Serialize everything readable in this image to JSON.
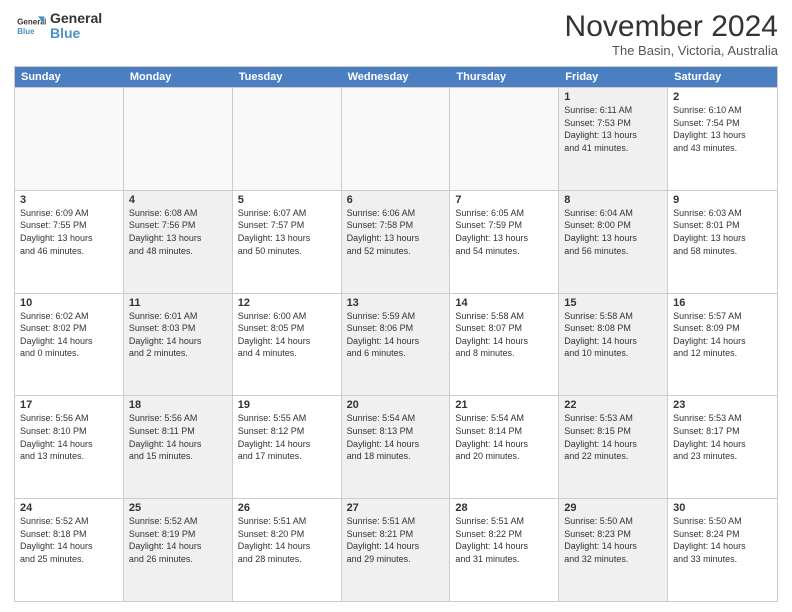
{
  "logo": {
    "line1": "General",
    "line2": "Blue"
  },
  "title": "November 2024",
  "location": "The Basin, Victoria, Australia",
  "header": {
    "days": [
      "Sunday",
      "Monday",
      "Tuesday",
      "Wednesday",
      "Thursday",
      "Friday",
      "Saturday"
    ]
  },
  "rows": [
    [
      {
        "day": "",
        "text": "",
        "empty": true
      },
      {
        "day": "",
        "text": "",
        "empty": true
      },
      {
        "day": "",
        "text": "",
        "empty": true
      },
      {
        "day": "",
        "text": "",
        "empty": true
      },
      {
        "day": "",
        "text": "",
        "empty": true
      },
      {
        "day": "1",
        "text": "Sunrise: 6:11 AM\nSunset: 7:53 PM\nDaylight: 13 hours\nand 41 minutes.",
        "shaded": true
      },
      {
        "day": "2",
        "text": "Sunrise: 6:10 AM\nSunset: 7:54 PM\nDaylight: 13 hours\nand 43 minutes.",
        "shaded": false
      }
    ],
    [
      {
        "day": "3",
        "text": "Sunrise: 6:09 AM\nSunset: 7:55 PM\nDaylight: 13 hours\nand 46 minutes.",
        "shaded": false
      },
      {
        "day": "4",
        "text": "Sunrise: 6:08 AM\nSunset: 7:56 PM\nDaylight: 13 hours\nand 48 minutes.",
        "shaded": true
      },
      {
        "day": "5",
        "text": "Sunrise: 6:07 AM\nSunset: 7:57 PM\nDaylight: 13 hours\nand 50 minutes.",
        "shaded": false
      },
      {
        "day": "6",
        "text": "Sunrise: 6:06 AM\nSunset: 7:58 PM\nDaylight: 13 hours\nand 52 minutes.",
        "shaded": true
      },
      {
        "day": "7",
        "text": "Sunrise: 6:05 AM\nSunset: 7:59 PM\nDaylight: 13 hours\nand 54 minutes.",
        "shaded": false
      },
      {
        "day": "8",
        "text": "Sunrise: 6:04 AM\nSunset: 8:00 PM\nDaylight: 13 hours\nand 56 minutes.",
        "shaded": true
      },
      {
        "day": "9",
        "text": "Sunrise: 6:03 AM\nSunset: 8:01 PM\nDaylight: 13 hours\nand 58 minutes.",
        "shaded": false
      }
    ],
    [
      {
        "day": "10",
        "text": "Sunrise: 6:02 AM\nSunset: 8:02 PM\nDaylight: 14 hours\nand 0 minutes.",
        "shaded": false
      },
      {
        "day": "11",
        "text": "Sunrise: 6:01 AM\nSunset: 8:03 PM\nDaylight: 14 hours\nand 2 minutes.",
        "shaded": true
      },
      {
        "day": "12",
        "text": "Sunrise: 6:00 AM\nSunset: 8:05 PM\nDaylight: 14 hours\nand 4 minutes.",
        "shaded": false
      },
      {
        "day": "13",
        "text": "Sunrise: 5:59 AM\nSunset: 8:06 PM\nDaylight: 14 hours\nand 6 minutes.",
        "shaded": true
      },
      {
        "day": "14",
        "text": "Sunrise: 5:58 AM\nSunset: 8:07 PM\nDaylight: 14 hours\nand 8 minutes.",
        "shaded": false
      },
      {
        "day": "15",
        "text": "Sunrise: 5:58 AM\nSunset: 8:08 PM\nDaylight: 14 hours\nand 10 minutes.",
        "shaded": true
      },
      {
        "day": "16",
        "text": "Sunrise: 5:57 AM\nSunset: 8:09 PM\nDaylight: 14 hours\nand 12 minutes.",
        "shaded": false
      }
    ],
    [
      {
        "day": "17",
        "text": "Sunrise: 5:56 AM\nSunset: 8:10 PM\nDaylight: 14 hours\nand 13 minutes.",
        "shaded": false
      },
      {
        "day": "18",
        "text": "Sunrise: 5:56 AM\nSunset: 8:11 PM\nDaylight: 14 hours\nand 15 minutes.",
        "shaded": true
      },
      {
        "day": "19",
        "text": "Sunrise: 5:55 AM\nSunset: 8:12 PM\nDaylight: 14 hours\nand 17 minutes.",
        "shaded": false
      },
      {
        "day": "20",
        "text": "Sunrise: 5:54 AM\nSunset: 8:13 PM\nDaylight: 14 hours\nand 18 minutes.",
        "shaded": true
      },
      {
        "day": "21",
        "text": "Sunrise: 5:54 AM\nSunset: 8:14 PM\nDaylight: 14 hours\nand 20 minutes.",
        "shaded": false
      },
      {
        "day": "22",
        "text": "Sunrise: 5:53 AM\nSunset: 8:15 PM\nDaylight: 14 hours\nand 22 minutes.",
        "shaded": true
      },
      {
        "day": "23",
        "text": "Sunrise: 5:53 AM\nSunset: 8:17 PM\nDaylight: 14 hours\nand 23 minutes.",
        "shaded": false
      }
    ],
    [
      {
        "day": "24",
        "text": "Sunrise: 5:52 AM\nSunset: 8:18 PM\nDaylight: 14 hours\nand 25 minutes.",
        "shaded": false
      },
      {
        "day": "25",
        "text": "Sunrise: 5:52 AM\nSunset: 8:19 PM\nDaylight: 14 hours\nand 26 minutes.",
        "shaded": true
      },
      {
        "day": "26",
        "text": "Sunrise: 5:51 AM\nSunset: 8:20 PM\nDaylight: 14 hours\nand 28 minutes.",
        "shaded": false
      },
      {
        "day": "27",
        "text": "Sunrise: 5:51 AM\nSunset: 8:21 PM\nDaylight: 14 hours\nand 29 minutes.",
        "shaded": true
      },
      {
        "day": "28",
        "text": "Sunrise: 5:51 AM\nSunset: 8:22 PM\nDaylight: 14 hours\nand 31 minutes.",
        "shaded": false
      },
      {
        "day": "29",
        "text": "Sunrise: 5:50 AM\nSunset: 8:23 PM\nDaylight: 14 hours\nand 32 minutes.",
        "shaded": true
      },
      {
        "day": "30",
        "text": "Sunrise: 5:50 AM\nSunset: 8:24 PM\nDaylight: 14 hours\nand 33 minutes.",
        "shaded": false
      }
    ]
  ]
}
